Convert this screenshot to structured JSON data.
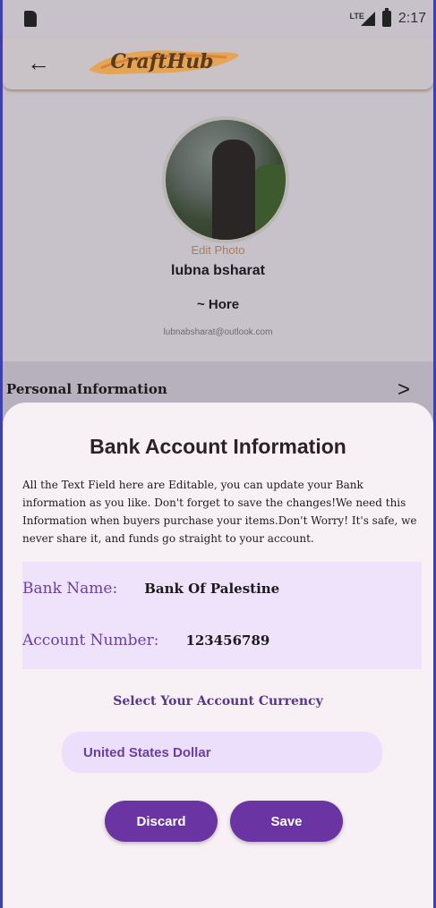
{
  "status_bar": {
    "network": "LTE",
    "time": "2:17"
  },
  "app_bar": {
    "logo_text": "CraftHub"
  },
  "profile": {
    "edit_photo": "Edit Photo",
    "name": "lubna bsharat",
    "role": "~ Hore",
    "email": "lubnabsharat@outlook.com"
  },
  "personal_row": {
    "label": "Personal Information"
  },
  "sheet": {
    "title": "Bank Account Information",
    "description": "All the Text Field here are Editable, you can update your Bank information as you like. Don't forget to save the changes!We need this Information when buyers purchase your items.Don't Worry! It's safe, we never share it, and funds go straight to your account.",
    "bank_name_label": "Bank Name:",
    "bank_name_value": "Bank Of Palestine",
    "account_number_label": "Account Number:",
    "account_number_value": "123456789",
    "currency_label": "Select Your Account Currency",
    "currency_value": "United States Dollar",
    "discard_label": "Discard",
    "save_label": "Save"
  },
  "colors": {
    "accent": "#6a34a3",
    "accent_light": "#efe3fb",
    "sheet_bg": "#f7f1f6"
  }
}
